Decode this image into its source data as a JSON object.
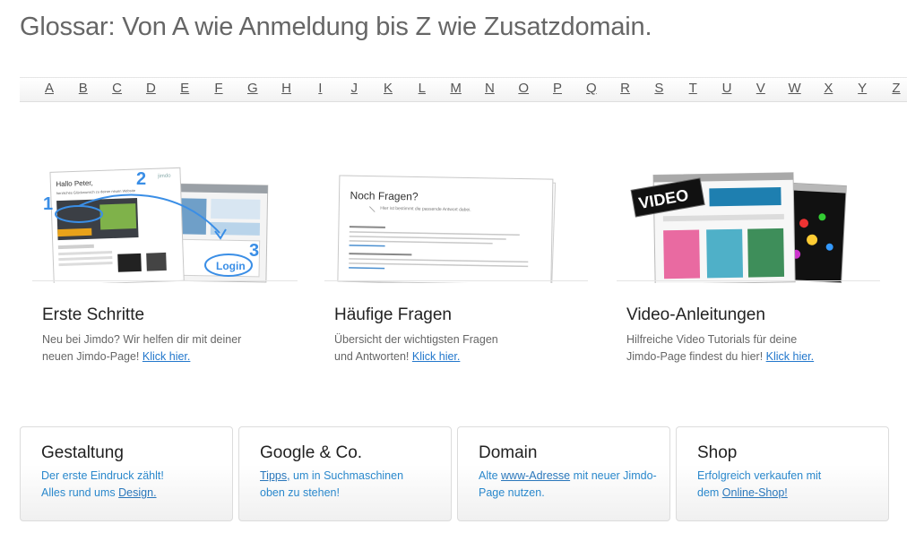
{
  "page": {
    "title": "Glossar: Von A wie Anmeldung bis Z wie Zusatzdomain."
  },
  "alphabet": [
    "A",
    "B",
    "C",
    "D",
    "E",
    "F",
    "G",
    "H",
    "I",
    "J",
    "K",
    "L",
    "M",
    "N",
    "O",
    "P",
    "Q",
    "R",
    "S",
    "T",
    "U",
    "V",
    "W",
    "X",
    "Y",
    "Z"
  ],
  "features": [
    {
      "title": "Erste Schritte",
      "text_line1": "Neu bei Jimdo? Wir helfen dir mit deiner",
      "text_line2": "neuen Jimdo-Page! ",
      "link": "Klick hier.",
      "shot": {
        "greeting": "Hallo Peter,",
        "greeting_sub": "herzliches Glückwunsch zu deiner neuen Website",
        "brand": "jimdo",
        "steps": [
          "1",
          "2",
          "3"
        ],
        "login": "Login"
      }
    },
    {
      "title": "Häufige Fragen",
      "text_line1": "Übersicht der wichtigsten Fragen",
      "text_line2": "und Antworten! ",
      "link": "Klick hier.",
      "shot": {
        "heading": "Noch Fragen?",
        "sub": "Hier ist bestimmt die passende Antwort dabei."
      }
    },
    {
      "title": "Video-Anleitungen",
      "text_line1": "Hilfreiche Video Tutorials für deine",
      "text_line2": "Jimdo-Page findest du hier! ",
      "link": "Klick hier.",
      "shot": {
        "badge": "VIDEO"
      }
    }
  ],
  "boxes": [
    {
      "title": "Gestaltung",
      "line1": "Der erste Eindruck zählt!",
      "line2_pre": "Alles rund ums ",
      "line2_link": "Design."
    },
    {
      "title": "Google & Co.",
      "line1_link": "Tipps,",
      "line1_post": " um in Suchmaschinen",
      "line2": "oben zu stehen!"
    },
    {
      "title": "Domain",
      "line1_pre": "Alte ",
      "line1_link": "www-Adresse",
      "line1_post": " mit neuer Jimdo-",
      "line2": "Page nutzen."
    },
    {
      "title": "Shop",
      "line1": "Erfolgreich verkaufen mit",
      "line2_pre": "dem ",
      "line2_link": "Online-Shop!"
    }
  ],
  "colors": {
    "link": "#2277cc",
    "title": "#666666",
    "accent_blue": "#3a8ee6"
  }
}
